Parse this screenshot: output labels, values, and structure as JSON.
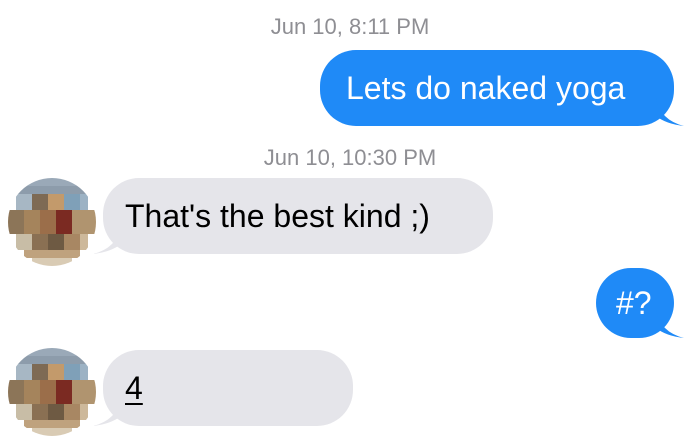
{
  "conversation": {
    "messages": [
      {
        "timestamp": "Jun 10,  8:11 PM",
        "direction": "outgoing",
        "text": "Lets do naked yoga"
      },
      {
        "timestamp": "Jun 10,  10:30 PM",
        "direction": "incoming",
        "text": "That's the best kind ;)"
      },
      {
        "direction": "outgoing",
        "text": "#?"
      },
      {
        "direction": "incoming",
        "text": "4"
      }
    ]
  },
  "colors": {
    "outgoing_bubble": "#1f8af7",
    "incoming_bubble": "#e5e5ea",
    "timestamp_text": "#8e8e93",
    "background": "#ffffff"
  },
  "icons": {
    "contact_avatar": "pixelated-avatar-icon"
  }
}
